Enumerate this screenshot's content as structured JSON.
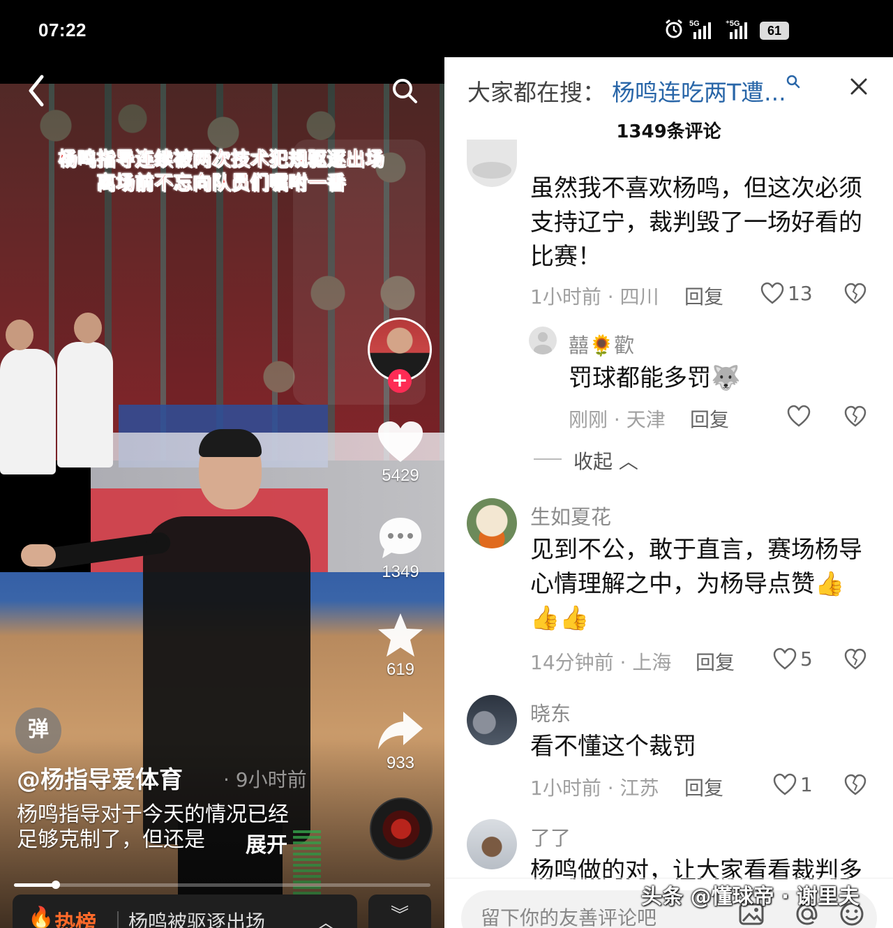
{
  "status_bar": {
    "time": "07:22",
    "battery": "61"
  },
  "video": {
    "caption_line1": "杨鸣指导连续被两次技术犯规驱逐出场",
    "caption_line2": "离场前不忘向队员们嘱咐一番",
    "likes": "5429",
    "comments": "1349",
    "favorites": "619",
    "shares": "933",
    "danmu_label": "弹",
    "author": "@杨指导爱体育",
    "post_time": "· 9小时前",
    "description": "杨鸣指导对于今天的情况已经足够克制了，但还是",
    "expand_label": "展开",
    "progress": 0.1,
    "hot": {
      "label": "热榜",
      "text": "杨鸣被驱逐出场"
    }
  },
  "comments_panel": {
    "trend_label": "大家都在搜：",
    "trend_query": "杨鸣连吃两T遭...",
    "count_label": "1349条评论",
    "items": [
      {
        "name": "",
        "text": "虽然我不喜欢杨鸣，但这次必须支持辽宁，裁判毁了一场好看的比赛！",
        "meta": "1小时前 · 四川",
        "reply": "回复",
        "likes": "13"
      },
      {
        "name": "囍🌻歡",
        "text": "罚球都能多罚🐺",
        "meta": "刚刚 · 天津",
        "reply": "回复",
        "likes": ""
      },
      {
        "name": "生如夏花",
        "text": "见到不公，敢于直言，赛场杨导心情理解之中，为杨导点赞👍👍👍",
        "meta": "14分钟前 · 上海",
        "reply": "回复",
        "likes": "5"
      },
      {
        "name": "晓东",
        "text": "看不懂这个裁罚",
        "meta": "1小时前 · 江苏",
        "reply": "回复",
        "likes": "1"
      },
      {
        "name": "了了",
        "text": "杨鸣做的对，让大家看看裁判多",
        "meta": "",
        "reply": "",
        "likes": ""
      }
    ],
    "collapse_label": "收起",
    "input_placeholder": "留下你的友善评论吧",
    "watermark": "头条 @懂球帝 · 谢里夫"
  },
  "colors": {
    "accent_link": "#2966a8",
    "follow_red": "#fe2c55",
    "hot_orange": "#ff6a2a"
  }
}
